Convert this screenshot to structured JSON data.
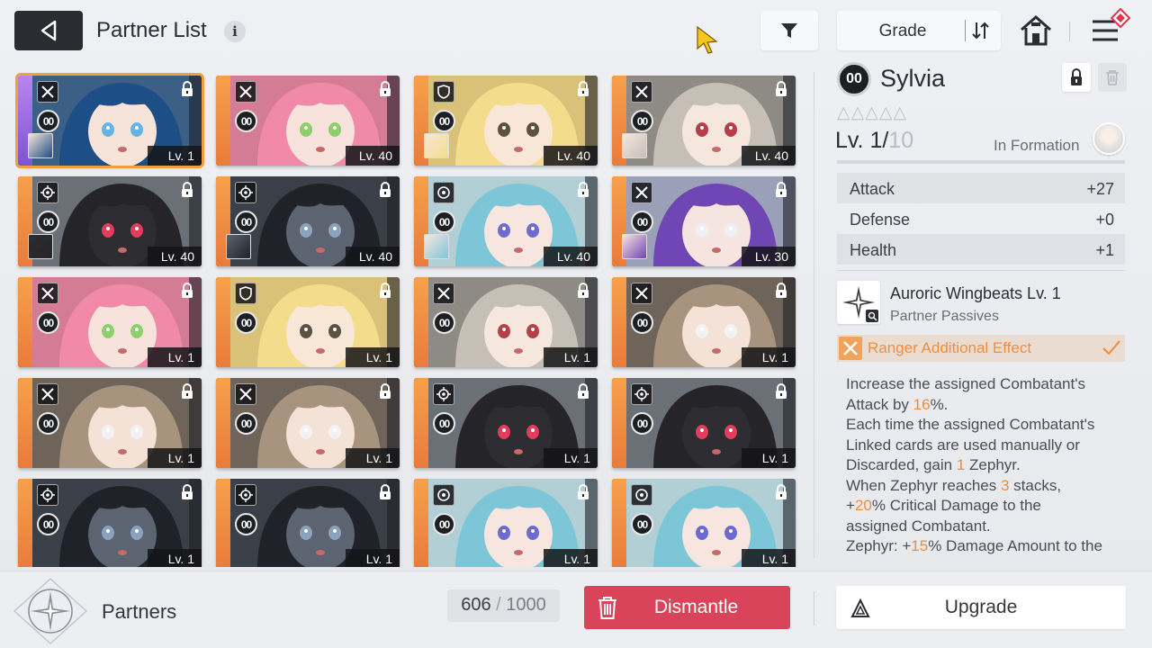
{
  "header": {
    "title": "Partner List",
    "info_glyph": "i",
    "grade_label": "Grade"
  },
  "icons": {
    "back": "back-arrow-icon",
    "info": "info-icon",
    "filter": "filter-icon",
    "sort": "sort-icon",
    "home": "home-icon",
    "menu": "menu-icon"
  },
  "colors": {
    "accent_orange": "#ee8c3c",
    "dismantle_red": "#d9445a",
    "selected_outline": "#f1a13a",
    "rarity_orange": "#f6a04a",
    "rarity_purple": "#9b6be0"
  },
  "cards": [
    {
      "level": "Lv. 1",
      "role": "sword",
      "grade": "00",
      "rarity": "purple",
      "palette": "blue-hair",
      "mini": true,
      "selected": true
    },
    {
      "level": "Lv. 40",
      "role": "sword",
      "grade": "00",
      "rarity": "orange",
      "palette": "pink-hair",
      "mini": false
    },
    {
      "level": "Lv. 40",
      "role": "shield",
      "grade": "00",
      "rarity": "orange",
      "palette": "blonde-hair",
      "mini": true
    },
    {
      "level": "Lv. 40",
      "role": "sword",
      "grade": "00",
      "rarity": "orange",
      "palette": "silver-hair",
      "mini": true
    },
    {
      "level": "Lv. 40",
      "role": "target",
      "grade": "00",
      "rarity": "orange",
      "palette": "black-mascot",
      "mini": true
    },
    {
      "level": "Lv. 40",
      "role": "target",
      "grade": "00",
      "rarity": "orange",
      "palette": "dark-mecha",
      "mini": true
    },
    {
      "level": "Lv. 40",
      "role": "circle",
      "grade": "00",
      "rarity": "orange",
      "palette": "teal-hair",
      "mini": true
    },
    {
      "level": "Lv. 30",
      "role": "sword",
      "grade": "00",
      "rarity": "orange",
      "palette": "purple-witch",
      "mini": true
    },
    {
      "level": "Lv. 1",
      "role": "sword",
      "grade": "00",
      "rarity": "orange",
      "palette": "pink-hair",
      "mini": false
    },
    {
      "level": "Lv. 1",
      "role": "shield",
      "grade": "00",
      "rarity": "orange",
      "palette": "blonde-hair",
      "mini": false
    },
    {
      "level": "Lv. 1",
      "role": "sword",
      "grade": "00",
      "rarity": "orange",
      "palette": "silver-hair",
      "mini": false
    },
    {
      "level": "Lv. 1",
      "role": "sword",
      "grade": "00",
      "rarity": "orange",
      "palette": "brown-hair",
      "mini": false
    },
    {
      "level": "Lv. 1",
      "role": "sword",
      "grade": "00",
      "rarity": "orange",
      "palette": "brown-hair",
      "mini": false
    },
    {
      "level": "Lv. 1",
      "role": "sword",
      "grade": "00",
      "rarity": "orange",
      "palette": "brown-hair",
      "mini": false
    },
    {
      "level": "Lv. 1",
      "role": "target",
      "grade": "00",
      "rarity": "orange",
      "palette": "black-mascot",
      "mini": false
    },
    {
      "level": "Lv. 1",
      "role": "target",
      "grade": "00",
      "rarity": "orange",
      "palette": "black-mascot",
      "mini": false
    },
    {
      "level": "Lv. 1",
      "role": "target",
      "grade": "00",
      "rarity": "orange",
      "palette": "dark-mecha",
      "mini": false
    },
    {
      "level": "Lv. 1",
      "role": "target",
      "grade": "00",
      "rarity": "orange",
      "palette": "dark-mecha",
      "mini": false
    },
    {
      "level": "Lv. 1",
      "role": "circle",
      "grade": "00",
      "rarity": "orange",
      "palette": "teal-hair",
      "mini": false
    },
    {
      "level": "Lv. 1",
      "role": "circle",
      "grade": "00",
      "rarity": "orange",
      "palette": "teal-hair",
      "mini": false
    }
  ],
  "detail": {
    "grade": "00",
    "name": "Sylvia",
    "stars": "△△△△△",
    "level_current": "Lv. 1/",
    "level_max": "10",
    "formation": "In Formation",
    "stats": [
      {
        "label": "Attack",
        "value": "+27"
      },
      {
        "label": "Defense",
        "value": "+0"
      },
      {
        "label": "Health",
        "value": "+1"
      }
    ],
    "skill_name": "Auroric Wingbeats Lv. 1",
    "skill_type": "Partner Passives",
    "effect_label": "Ranger Additional Effect",
    "desc": {
      "l1": "Increase the assigned Combatant's",
      "l2a": "Attack by ",
      "l2b": "16",
      "l2c": "%.",
      "l3": "Each time the assigned Combatant's",
      "l4": "Linked cards are used manually or",
      "l5a": "Discarded, gain ",
      "l5b": "1",
      "l5c": " Zephyr.",
      "l6a": "When Zephyr reaches ",
      "l6b": "3",
      "l6c": " stacks,",
      "l7a": "+",
      "l7b": "20",
      "l7c": "% Critical Damage to the",
      "l8": "assigned Combatant.",
      "l9a": "Zephyr: +",
      "l9b": "15",
      "l9c": "% Damage Amount to the"
    }
  },
  "footer": {
    "label": "Partners",
    "count": "606",
    "sep": " / ",
    "max": "1000",
    "dismantle": "Dismantle",
    "upgrade": "Upgrade"
  }
}
